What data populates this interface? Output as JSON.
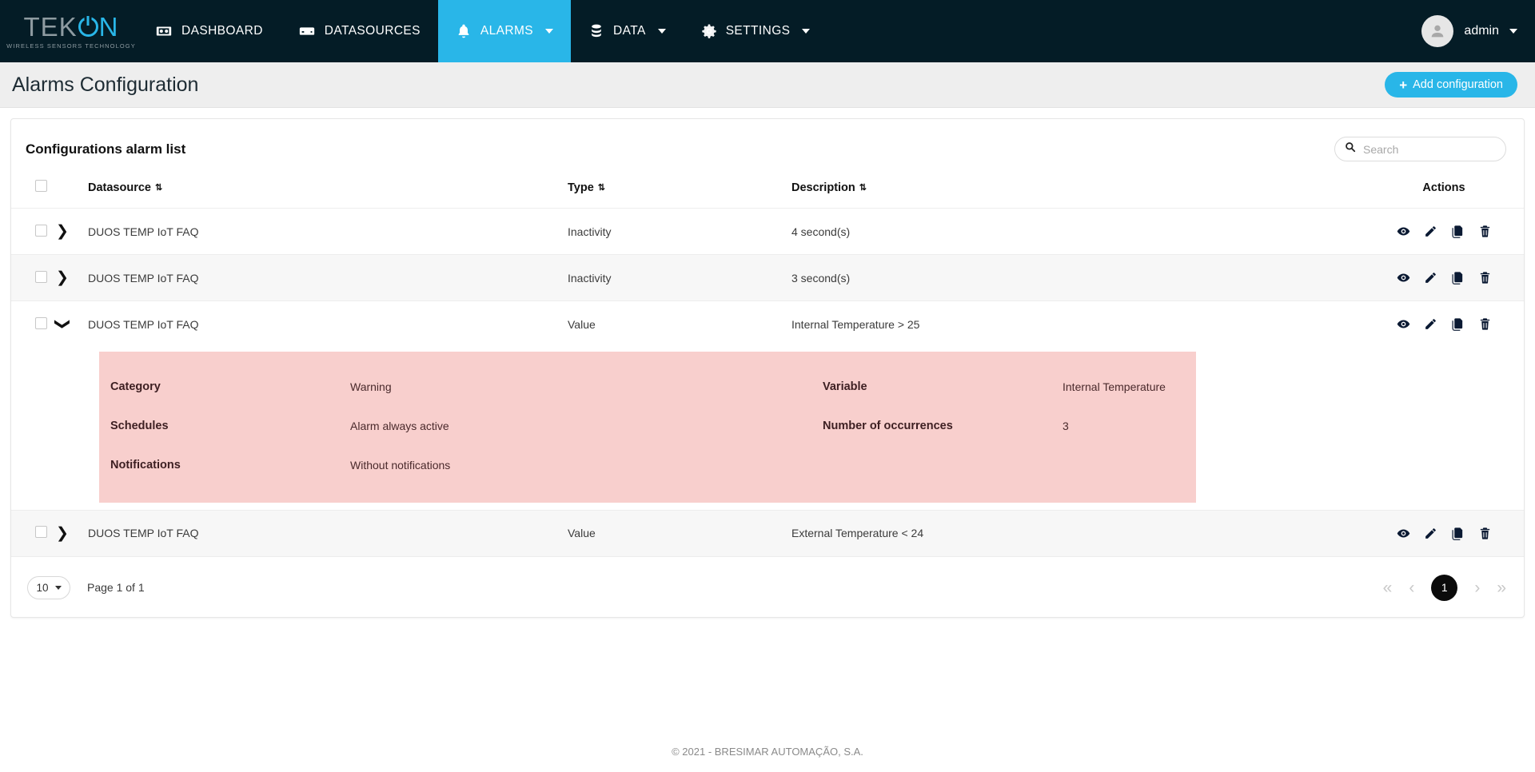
{
  "brand": {
    "name_part1": "TEK",
    "name_part2": "N",
    "tagline": "WIRELESS SENSORS TECHNOLOGY"
  },
  "navbar": {
    "items": [
      {
        "label": "DASHBOARD",
        "icon": "dashboard-icon",
        "active": false,
        "caret": false
      },
      {
        "label": "DATASOURCES",
        "icon": "datasources-icon",
        "active": false,
        "caret": false
      },
      {
        "label": "ALARMS",
        "icon": "bell-icon",
        "active": true,
        "caret": true
      },
      {
        "label": "DATA",
        "icon": "database-icon",
        "active": false,
        "caret": true
      },
      {
        "label": "SETTINGS",
        "icon": "gear-icon",
        "active": false,
        "caret": true
      }
    ],
    "user": {
      "name": "admin",
      "avatar_icon": "person-icon"
    },
    "accent_color": "#29b6e8",
    "background_color": "#041c26"
  },
  "page": {
    "title": "Alarms Configuration",
    "add_button_label": "Add configuration",
    "add_button_icon": "plus-icon"
  },
  "card": {
    "title": "Configurations alarm list",
    "search": {
      "placeholder": "Search",
      "value": "",
      "icon": "search-icon"
    }
  },
  "table": {
    "columns": [
      {
        "label": "Datasource",
        "sortable": true
      },
      {
        "label": "Type",
        "sortable": true
      },
      {
        "label": "Description",
        "sortable": true
      },
      {
        "label": "Actions",
        "sortable": false
      }
    ],
    "action_icons": [
      "eye-icon",
      "pencil-icon",
      "copy-icon",
      "trash-icon"
    ],
    "rows": [
      {
        "datasource": "DUOS TEMP IoT FAQ",
        "type": "Inactivity",
        "description": "4 second(s)",
        "expanded": false
      },
      {
        "datasource": "DUOS TEMP IoT FAQ",
        "type": "Inactivity",
        "description": "3 second(s)",
        "expanded": false
      },
      {
        "datasource": "DUOS TEMP IoT FAQ",
        "type": "Value",
        "description": "Internal Temperature > 25",
        "expanded": true,
        "detail": {
          "background_color": "#f8cfcd",
          "left": [
            {
              "key": "Category",
              "value": "Warning"
            },
            {
              "key": "Schedules",
              "value": "Alarm always active"
            },
            {
              "key": "Notifications",
              "value": "Without notifications"
            }
          ],
          "right": [
            {
              "key": "Variable",
              "value": "Internal Temperature"
            },
            {
              "key": "Number of occurrences",
              "value": "3"
            }
          ]
        }
      },
      {
        "datasource": "DUOS TEMP IoT FAQ",
        "type": "Value",
        "description": "External Temperature < 24",
        "expanded": false
      }
    ]
  },
  "pagination": {
    "page_size": "10",
    "page_info": "Page 1 of 1",
    "first_label": "«",
    "prev_label": "‹",
    "current_page": "1",
    "next_label": "›",
    "last_label": "»"
  },
  "footer": {
    "text": "© 2021 - BRESIMAR AUTOMAÇÃO, S.A."
  }
}
